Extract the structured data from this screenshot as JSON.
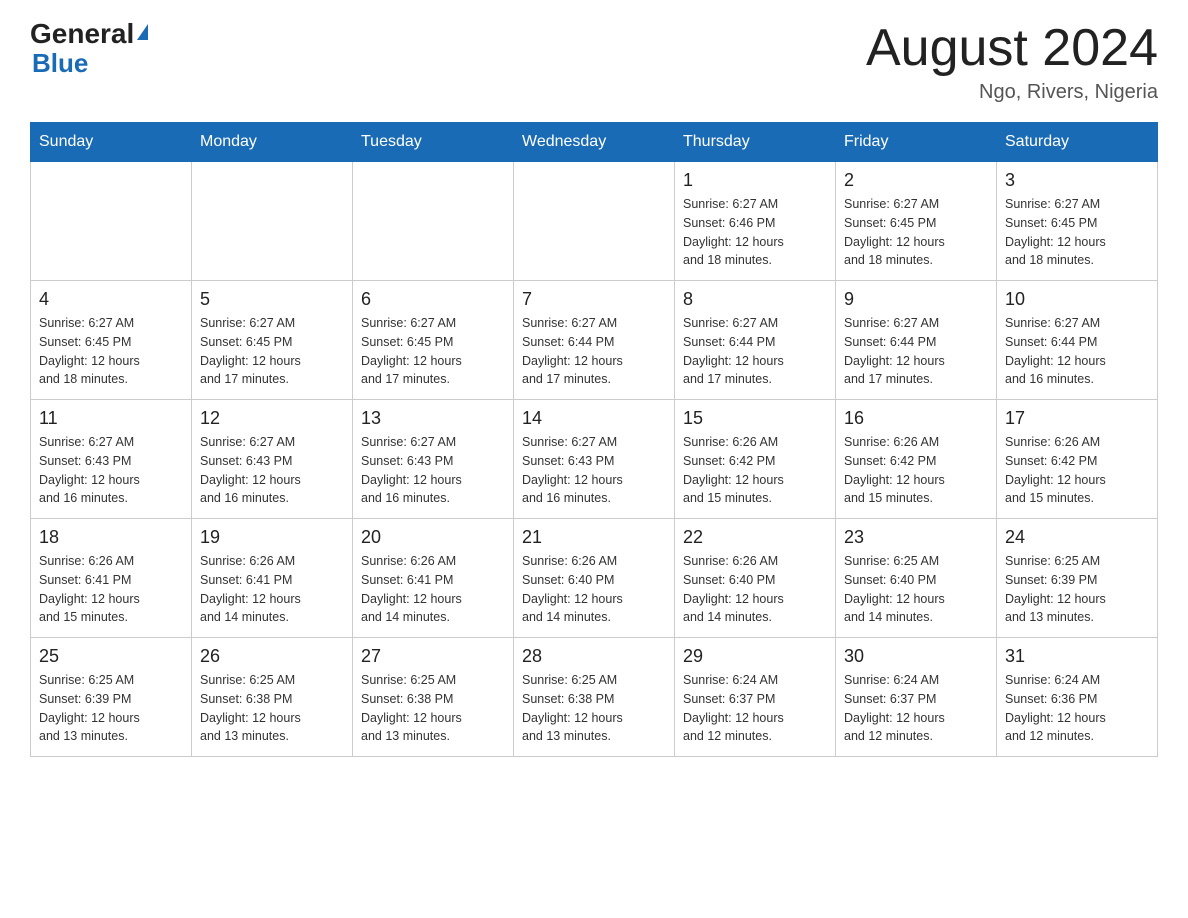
{
  "header": {
    "logo_main": "General",
    "logo_sub": "Blue",
    "title": "August 2024",
    "location": "Ngo, Rivers, Nigeria"
  },
  "days_of_week": [
    "Sunday",
    "Monday",
    "Tuesday",
    "Wednesday",
    "Thursday",
    "Friday",
    "Saturday"
  ],
  "weeks": [
    [
      {
        "day": "",
        "info": ""
      },
      {
        "day": "",
        "info": ""
      },
      {
        "day": "",
        "info": ""
      },
      {
        "day": "",
        "info": ""
      },
      {
        "day": "1",
        "info": "Sunrise: 6:27 AM\nSunset: 6:46 PM\nDaylight: 12 hours\nand 18 minutes."
      },
      {
        "day": "2",
        "info": "Sunrise: 6:27 AM\nSunset: 6:45 PM\nDaylight: 12 hours\nand 18 minutes."
      },
      {
        "day": "3",
        "info": "Sunrise: 6:27 AM\nSunset: 6:45 PM\nDaylight: 12 hours\nand 18 minutes."
      }
    ],
    [
      {
        "day": "4",
        "info": "Sunrise: 6:27 AM\nSunset: 6:45 PM\nDaylight: 12 hours\nand 18 minutes."
      },
      {
        "day": "5",
        "info": "Sunrise: 6:27 AM\nSunset: 6:45 PM\nDaylight: 12 hours\nand 17 minutes."
      },
      {
        "day": "6",
        "info": "Sunrise: 6:27 AM\nSunset: 6:45 PM\nDaylight: 12 hours\nand 17 minutes."
      },
      {
        "day": "7",
        "info": "Sunrise: 6:27 AM\nSunset: 6:44 PM\nDaylight: 12 hours\nand 17 minutes."
      },
      {
        "day": "8",
        "info": "Sunrise: 6:27 AM\nSunset: 6:44 PM\nDaylight: 12 hours\nand 17 minutes."
      },
      {
        "day": "9",
        "info": "Sunrise: 6:27 AM\nSunset: 6:44 PM\nDaylight: 12 hours\nand 17 minutes."
      },
      {
        "day": "10",
        "info": "Sunrise: 6:27 AM\nSunset: 6:44 PM\nDaylight: 12 hours\nand 16 minutes."
      }
    ],
    [
      {
        "day": "11",
        "info": "Sunrise: 6:27 AM\nSunset: 6:43 PM\nDaylight: 12 hours\nand 16 minutes."
      },
      {
        "day": "12",
        "info": "Sunrise: 6:27 AM\nSunset: 6:43 PM\nDaylight: 12 hours\nand 16 minutes."
      },
      {
        "day": "13",
        "info": "Sunrise: 6:27 AM\nSunset: 6:43 PM\nDaylight: 12 hours\nand 16 minutes."
      },
      {
        "day": "14",
        "info": "Sunrise: 6:27 AM\nSunset: 6:43 PM\nDaylight: 12 hours\nand 16 minutes."
      },
      {
        "day": "15",
        "info": "Sunrise: 6:26 AM\nSunset: 6:42 PM\nDaylight: 12 hours\nand 15 minutes."
      },
      {
        "day": "16",
        "info": "Sunrise: 6:26 AM\nSunset: 6:42 PM\nDaylight: 12 hours\nand 15 minutes."
      },
      {
        "day": "17",
        "info": "Sunrise: 6:26 AM\nSunset: 6:42 PM\nDaylight: 12 hours\nand 15 minutes."
      }
    ],
    [
      {
        "day": "18",
        "info": "Sunrise: 6:26 AM\nSunset: 6:41 PM\nDaylight: 12 hours\nand 15 minutes."
      },
      {
        "day": "19",
        "info": "Sunrise: 6:26 AM\nSunset: 6:41 PM\nDaylight: 12 hours\nand 14 minutes."
      },
      {
        "day": "20",
        "info": "Sunrise: 6:26 AM\nSunset: 6:41 PM\nDaylight: 12 hours\nand 14 minutes."
      },
      {
        "day": "21",
        "info": "Sunrise: 6:26 AM\nSunset: 6:40 PM\nDaylight: 12 hours\nand 14 minutes."
      },
      {
        "day": "22",
        "info": "Sunrise: 6:26 AM\nSunset: 6:40 PM\nDaylight: 12 hours\nand 14 minutes."
      },
      {
        "day": "23",
        "info": "Sunrise: 6:25 AM\nSunset: 6:40 PM\nDaylight: 12 hours\nand 14 minutes."
      },
      {
        "day": "24",
        "info": "Sunrise: 6:25 AM\nSunset: 6:39 PM\nDaylight: 12 hours\nand 13 minutes."
      }
    ],
    [
      {
        "day": "25",
        "info": "Sunrise: 6:25 AM\nSunset: 6:39 PM\nDaylight: 12 hours\nand 13 minutes."
      },
      {
        "day": "26",
        "info": "Sunrise: 6:25 AM\nSunset: 6:38 PM\nDaylight: 12 hours\nand 13 minutes."
      },
      {
        "day": "27",
        "info": "Sunrise: 6:25 AM\nSunset: 6:38 PM\nDaylight: 12 hours\nand 13 minutes."
      },
      {
        "day": "28",
        "info": "Sunrise: 6:25 AM\nSunset: 6:38 PM\nDaylight: 12 hours\nand 13 minutes."
      },
      {
        "day": "29",
        "info": "Sunrise: 6:24 AM\nSunset: 6:37 PM\nDaylight: 12 hours\nand 12 minutes."
      },
      {
        "day": "30",
        "info": "Sunrise: 6:24 AM\nSunset: 6:37 PM\nDaylight: 12 hours\nand 12 minutes."
      },
      {
        "day": "31",
        "info": "Sunrise: 6:24 AM\nSunset: 6:36 PM\nDaylight: 12 hours\nand 12 minutes."
      }
    ]
  ]
}
